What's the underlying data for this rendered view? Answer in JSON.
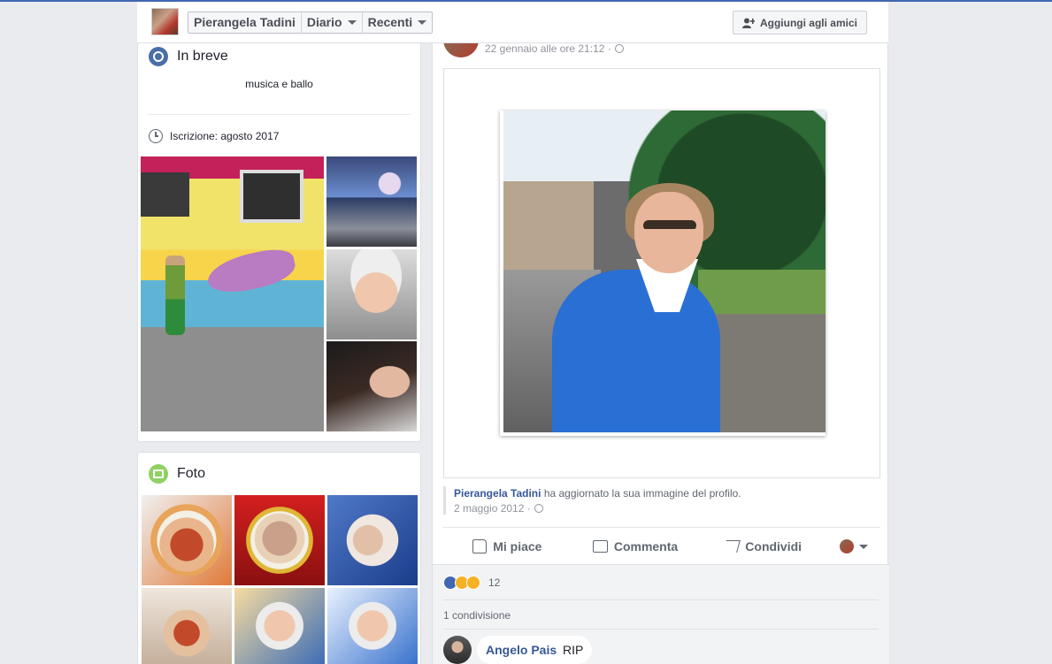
{
  "header": {
    "name": "Pierangela Tadini",
    "tabs": [
      {
        "label": "Diario"
      },
      {
        "label": "Recenti"
      }
    ],
    "add_friend": "Aggiungi agli amici"
  },
  "intro": {
    "title": "In breve",
    "bio": "musica e ballo",
    "joined": "Iscrizione: agosto 2017"
  },
  "photos": {
    "title": "Foto"
  },
  "post": {
    "date": "22 gennaio alle ore 21:12 ·",
    "shared_author": "Pierangela Tadini",
    "shared_text": "ha aggiornato la sua immagine del profilo.",
    "shared_date": "2 maggio 2012 ·",
    "actions": {
      "like": "Mi piace",
      "comment": "Commenta",
      "share": "Condividi"
    },
    "reactions_count": "12",
    "shares": "1 condivisione",
    "comment": {
      "author": "Angelo Pais",
      "text": "RIP"
    }
  },
  "colors": {
    "brand": "#4267b2",
    "link": "#365899",
    "background": "#e9ebee"
  }
}
